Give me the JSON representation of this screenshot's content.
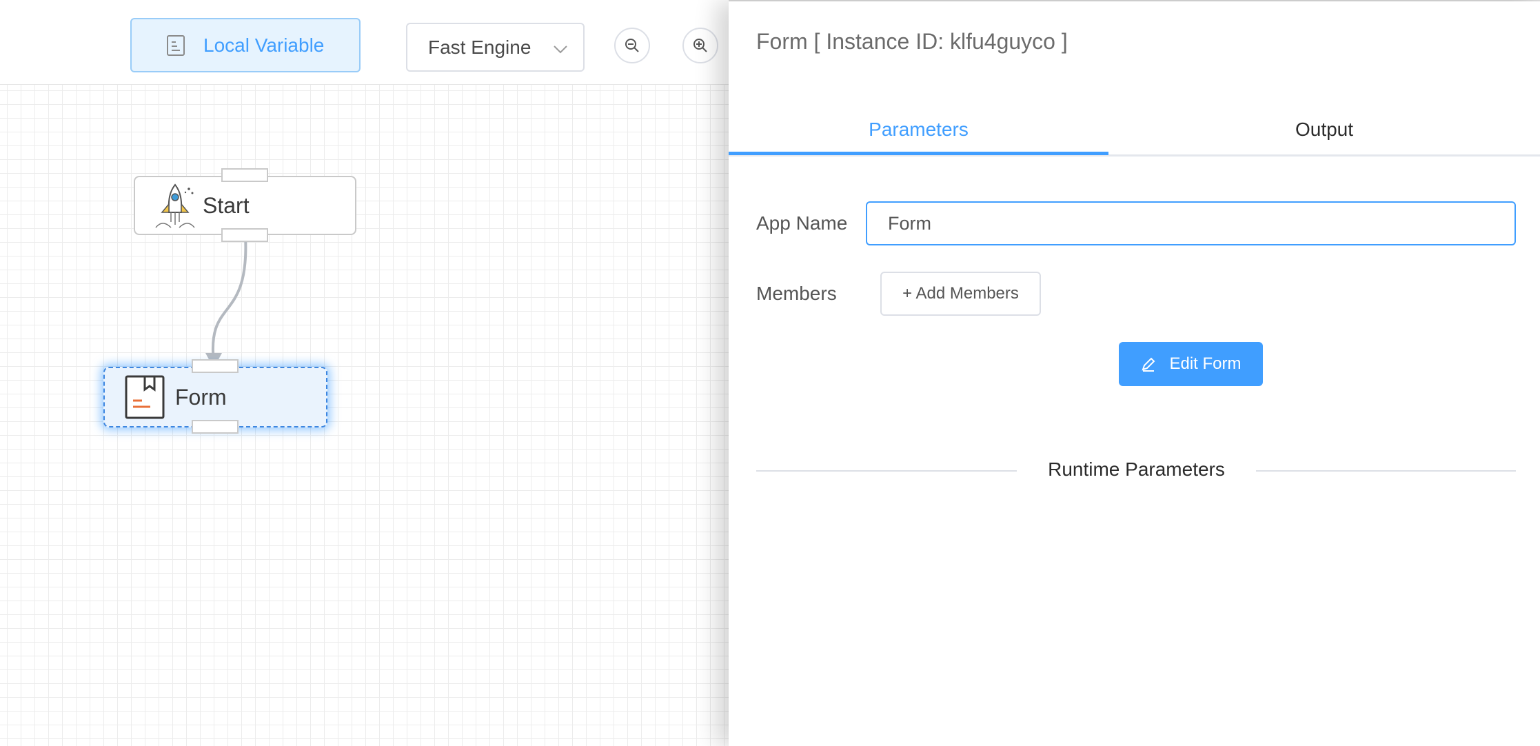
{
  "toolbar": {
    "local_variable_label": "Local Variable",
    "engine_select_value": "Fast Engine"
  },
  "canvas": {
    "nodes": [
      {
        "label": "Start",
        "icon": "rocket-icon"
      },
      {
        "label": "Form",
        "icon": "form-icon",
        "selected": true
      }
    ]
  },
  "panel": {
    "title": "Form [ Instance ID: klfu4guyco ]",
    "tabs": [
      {
        "label": "Parameters",
        "active": true
      },
      {
        "label": "Output",
        "active": false
      }
    ],
    "app_name_label": "App Name",
    "app_name_value": "Form",
    "members_label": "Members",
    "add_members_label": "+ Add Members",
    "edit_form_label": "Edit Form",
    "runtime_parameters_label": "Runtime Parameters"
  },
  "colors": {
    "accent": "#409eff",
    "selected_node_bg": "#eaf3fd",
    "form_icon_accent": "#e8703a"
  }
}
